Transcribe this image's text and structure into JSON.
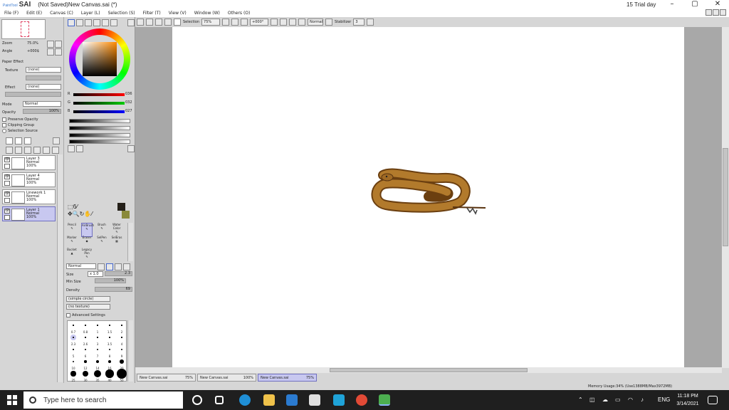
{
  "app": {
    "logo_small": "PaintTool",
    "logo": "SAI",
    "document_title": "(Not Saved)New Canvas.sai (*)",
    "trial_text": "15 Trial day"
  },
  "menu": [
    "File (F)",
    "Edit (E)",
    "Canvas (C)",
    "Layer (L)",
    "Selection (S)",
    "Filter (T)",
    "View (V)",
    "Window (W)",
    "Others (O)"
  ],
  "toolbar": {
    "selection_label": "Selection",
    "zoom": "75%",
    "rotation": "+000°",
    "mode": "Normal",
    "stabilizer_label": "Stabilizer",
    "stabilizer_value": "3"
  },
  "navigator": {
    "zoom_label": "Zoom",
    "zoom_value": "75.0%",
    "angle_label": "Angle",
    "angle_value": "+000$"
  },
  "paper_effect": {
    "header": "Paper Effect",
    "texture_label": "Texture",
    "texture_value": "(none)",
    "effect_label": "Effect",
    "effect_value": "(none)"
  },
  "layer_props": {
    "mode_label": "Mode",
    "mode_value": "Normal",
    "opacity_label": "Opacity",
    "opacity_value": "100%",
    "preserve_opacity": "Preserve Opacity",
    "clipping_group": "Clipping Group",
    "selection_source": "Selection Source"
  },
  "layers": [
    {
      "name": "Layer 3",
      "mode": "Normal",
      "opacity": "100%"
    },
    {
      "name": "Layer 4",
      "mode": "Normal",
      "opacity": "100%"
    },
    {
      "name": "Linework 1",
      "mode": "Normal",
      "opacity": "100%"
    },
    {
      "name": "Layer 1",
      "mode": "Normal",
      "opacity": "100%"
    }
  ],
  "color": {
    "r_label": "R",
    "r_value": "036",
    "g_label": "G",
    "g_value": "032",
    "b_label": "B",
    "b_value": "027",
    "current": "#242019",
    "secondary": "#8a8a3a",
    "hue_accent": "#ff8a00"
  },
  "tools": [
    {
      "name": "Pencil"
    },
    {
      "name": "AirBrush"
    },
    {
      "name": "Brush"
    },
    {
      "name": "Water Color"
    },
    {
      "name": "Marker"
    },
    {
      "name": "Eraser"
    },
    {
      "name": "SelPen"
    },
    {
      "name": "SelEras"
    },
    {
      "name": "Bucket"
    },
    {
      "name": "Legacy Pen"
    }
  ],
  "brush": {
    "mode": "Normal",
    "size_label": "Size",
    "size_mult": "x 1.0",
    "size_value": "2.3",
    "min_size_label": "Min Size",
    "min_size_value": "100%",
    "density_label": "Density",
    "density_value": "69",
    "shape": "(simple circle)",
    "texture": "(no texture)",
    "advanced": "Advanced Settings"
  },
  "brush_sizes": [
    "0.7",
    "0.8",
    "1",
    "1.5",
    "2",
    "2.3",
    "2.6",
    "3",
    "3.5",
    "4",
    "5",
    "6",
    "7",
    "8",
    "9",
    "10",
    "12",
    "14",
    "16",
    "20",
    "25",
    "30",
    "35",
    "40",
    "50"
  ],
  "tabs": [
    {
      "name": "New Canvas.sai",
      "zoom": "75%"
    },
    {
      "name": "New Canvas.sai",
      "zoom": "100%"
    },
    {
      "name": "New Canvas.sai",
      "zoom": "75%"
    }
  ],
  "status": {
    "memory": "Memory Usage:34% (Use1388MB/Max3972MB)"
  },
  "taskbar": {
    "search_placeholder": "Type here to search",
    "lang": "ENG",
    "time": "11:18 PM",
    "date": "3/14/2021"
  }
}
